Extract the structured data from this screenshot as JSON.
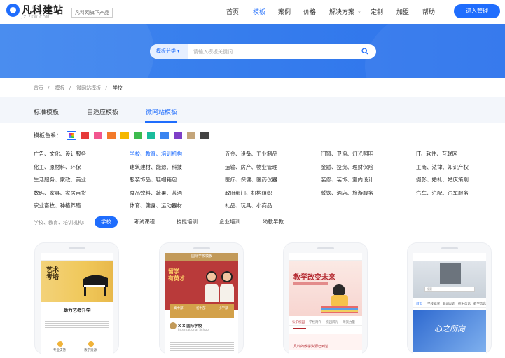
{
  "header": {
    "logo_text": "凡科建站",
    "logo_sub": "JZ.FKW.COM",
    "slogan": "凡科网旗下产品",
    "nav": [
      {
        "label": "首页",
        "active": false
      },
      {
        "label": "模板",
        "active": true
      },
      {
        "label": "案例",
        "active": false
      },
      {
        "label": "价格",
        "active": false
      },
      {
        "label": "解决方案",
        "active": false
      },
      {
        "label": "定制",
        "active": false
      },
      {
        "label": "加盟",
        "active": false
      },
      {
        "label": "帮助",
        "active": false
      }
    ],
    "enter_button": "进入管理"
  },
  "search": {
    "category_label": "模板分类",
    "placeholder": "请输入模板关键词"
  },
  "breadcrumb": [
    "首页",
    "模板",
    "微网站模板",
    "学校"
  ],
  "tabs": [
    {
      "label": "标准模板",
      "active": false
    },
    {
      "label": "自适应模板",
      "active": false
    },
    {
      "label": "微网站模板",
      "active": true
    }
  ],
  "color_filter": {
    "label": "模板色系：",
    "colors": [
      "multi",
      "#e63a3a",
      "#f2568f",
      "#f37a2a",
      "#f5b800",
      "#3dba4e",
      "#1abc9c",
      "#3a84f0",
      "#7e3fc7",
      "#c4a57a",
      "#444444"
    ]
  },
  "categories": [
    [
      "广告、文化、设计服务",
      "学校、教育、培训机构",
      "五金、设备、工业制品",
      "门窗、卫浴、灯光照明",
      "IT、软件、互联网"
    ],
    [
      "化工、原材料、环保",
      "建筑建材、能源、科技",
      "运输、房产、物业管理",
      "金融、投资、理财保险",
      "工商、法律、知识产权"
    ],
    [
      "生活服务、家政、美业",
      "服装饰品、鞋帽箱包",
      "医疗、保健、医药仪器",
      "装修、装饰、室内设计",
      "摄影、婚礼、婚庆策划"
    ],
    [
      "数码、家具、家居百货",
      "食品饮料、蔬果、茶酒",
      "政府部门、机构组织",
      "餐饮、酒店、旅游服务",
      "汽车、汽配、汽车服务"
    ],
    [
      "农业畜牧、种植养殖",
      "体育、健身、运动器材",
      "礼品、玩具、小商品"
    ]
  ],
  "active_category": "学校、教育、培训机构",
  "sub_filter": {
    "label": "学校、教育、培训机构:",
    "pills": [
      {
        "label": "学校",
        "active": true
      },
      {
        "label": "考试课程",
        "active": false
      },
      {
        "label": "技能培训",
        "active": false
      },
      {
        "label": "企业培训",
        "active": false
      },
      {
        "label": "幼教早教",
        "active": false
      }
    ]
  },
  "templates": [
    {
      "title_art": "艺术\n考培",
      "heading": "助力艺考升学",
      "icon_labels": [
        "专业支持",
        "教学资源"
      ]
    },
    {
      "top_title": "国际学校模板",
      "hero_text": "留学\n有英才",
      "sections": [
        "高中部",
        "初中部",
        "小学部"
      ],
      "school_name": "X X 国际学校",
      "school_sub": "International School"
    },
    {
      "hero_text": "教学改变未来",
      "menu": [
        "认识校园",
        "学校简介",
        "校园风光",
        "师资力量"
      ],
      "news": "凡科的教学资源已到达"
    },
    {
      "search_text": "搜索",
      "menu": [
        "首页",
        "学校概况",
        "新闻动态",
        "招生信息",
        "教学信息"
      ],
      "banner_text": "心之所向"
    }
  ]
}
